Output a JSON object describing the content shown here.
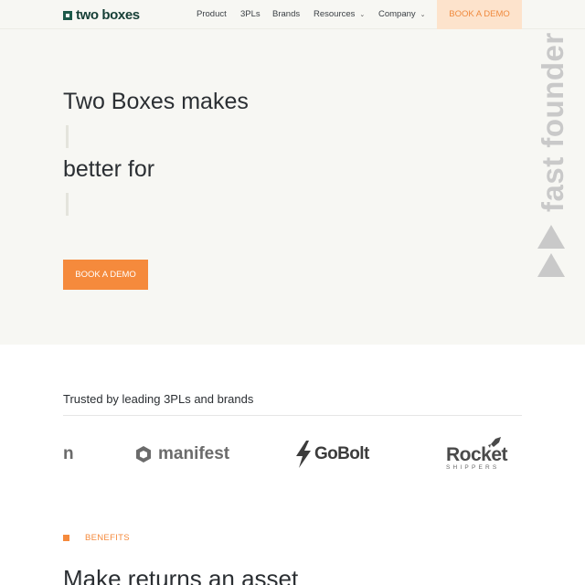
{
  "header": {
    "logo_text": "two boxes",
    "nav": [
      {
        "label": "Product"
      },
      {
        "label": "3PLs"
      },
      {
        "label": "Brands"
      },
      {
        "label": "Resources"
      },
      {
        "label": "Company"
      }
    ],
    "cta_label": "BOOK A DEMO"
  },
  "hero": {
    "line1": "Two Boxes makes",
    "line2": "better for",
    "cta_label": "BOOK A DEMO",
    "badge_text": "fast founder"
  },
  "trusted": {
    "heading": "Trusted by leading 3PLs and brands",
    "logos": [
      {
        "name": "n"
      },
      {
        "name": "manifest"
      },
      {
        "name": "GoBolt"
      },
      {
        "name": "Rocket",
        "sub": "SHIPPERS"
      }
    ]
  },
  "benefits": {
    "label": "BENEFITS",
    "title": "Make returns an asset"
  },
  "colors": {
    "accent": "#f58a3c",
    "brand": "#1d5a4a",
    "hero_bg": "#f7f7f3"
  }
}
